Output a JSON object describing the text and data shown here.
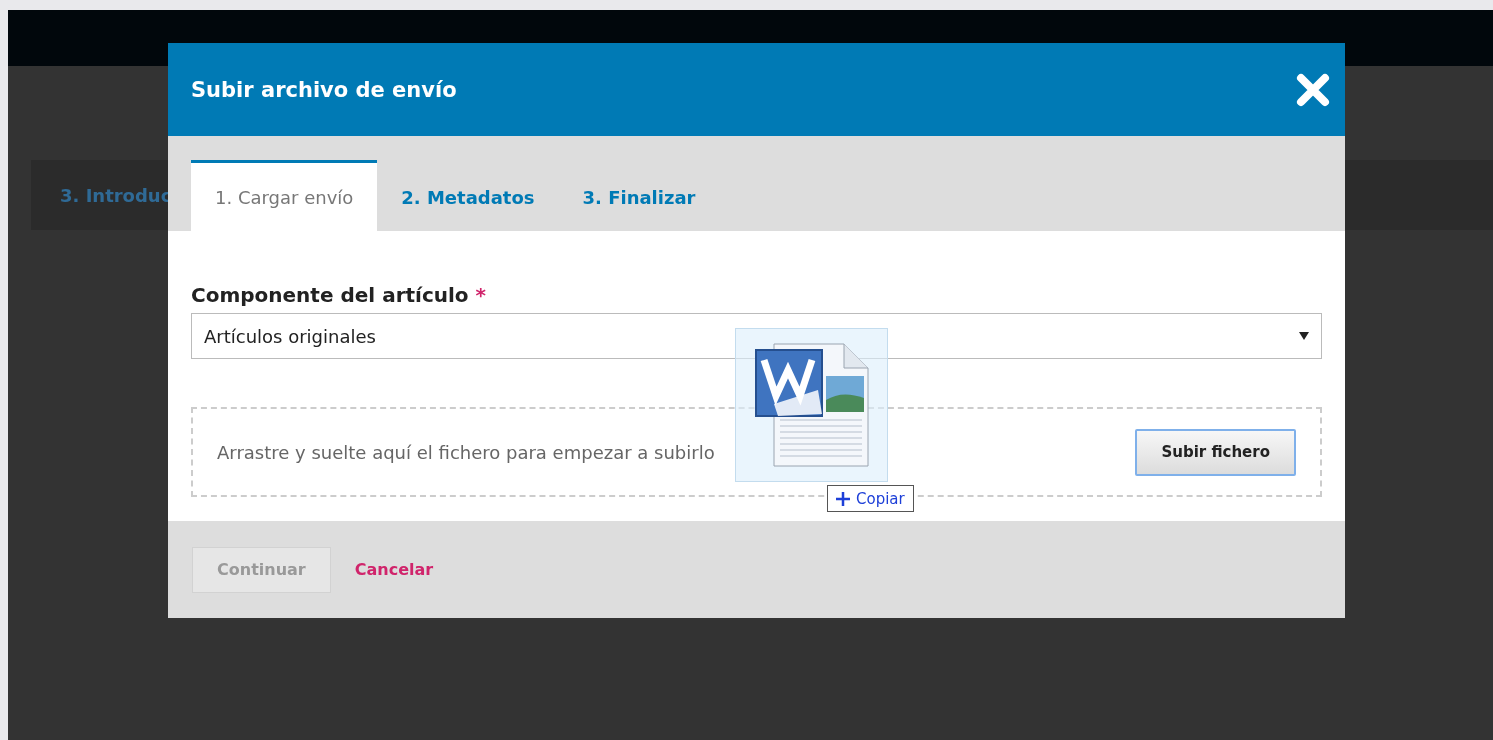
{
  "background": {
    "tab": "3. Introduc"
  },
  "dialog": {
    "title": "Subir archivo de envío",
    "tabs": [
      {
        "label": "1. Cargar envío",
        "selected": true
      },
      {
        "label": "2. Metadatos",
        "selected": false
      },
      {
        "label": "3. Finalizar",
        "selected": false
      }
    ],
    "field": {
      "label": "Componente del artículo",
      "required_mark": "*",
      "value": "Artículos originales"
    },
    "dropzone": {
      "text": "Arrastre y suelte aquí el fichero para empezar a subirlo",
      "button": "Subir fichero"
    },
    "actions": {
      "continue": {
        "label": "Continuar",
        "disabled": true
      },
      "cancel": "Cancelar"
    }
  },
  "drag": {
    "badge": "Copiar"
  }
}
